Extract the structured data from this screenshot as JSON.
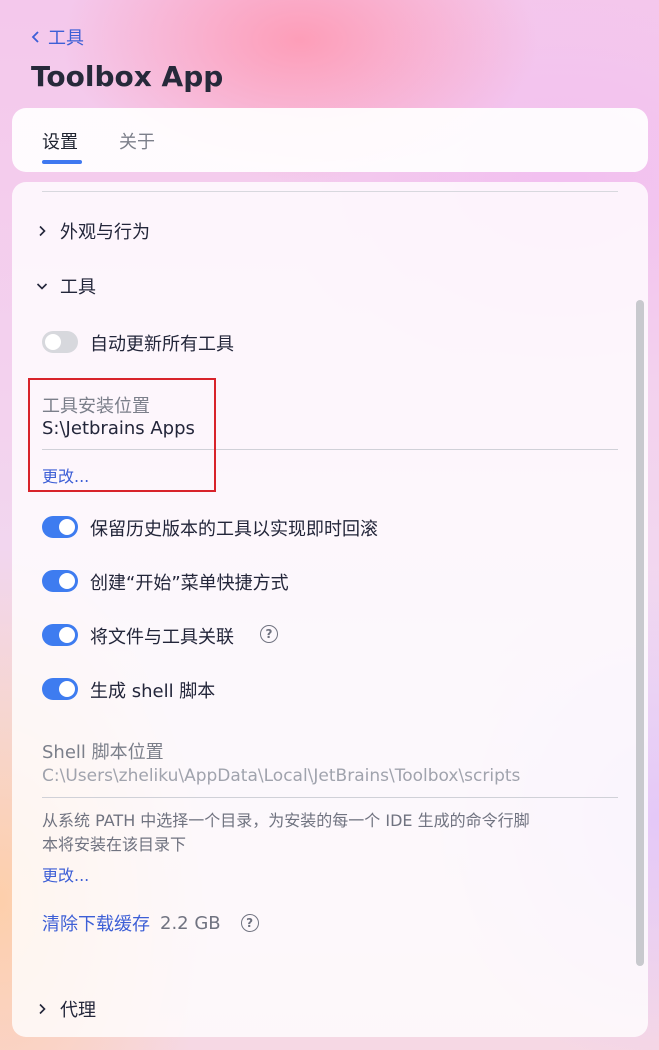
{
  "header": {
    "back_label": "工具",
    "title": "Toolbox App"
  },
  "tabs": [
    {
      "label": "设置",
      "active": true
    },
    {
      "label": "关于",
      "active": false
    }
  ],
  "sections": {
    "appearance": "外观与行为",
    "tools": "工具",
    "proxy": "代理"
  },
  "options": {
    "auto_update": {
      "label": "自动更新所有工具",
      "enabled": false
    },
    "keep_rollback": {
      "label": "保留历史版本的工具以实现即时回滚",
      "enabled": true
    },
    "start_menu": {
      "label": "创建“开始”菜单快捷方式",
      "enabled": true
    },
    "associate_files": {
      "label": "将文件与工具关联",
      "enabled": true
    },
    "shell_scripts": {
      "label": "生成 shell 脚本",
      "enabled": true
    }
  },
  "install_location": {
    "label": "工具安装位置",
    "value": "S:\\Jetbrains Apps",
    "change": "更改..."
  },
  "shell_location": {
    "label": "Shell 脚本位置",
    "value": "C:\\Users\\zheliku\\AppData\\Local\\JetBrains\\Toolbox\\scripts",
    "description": "从系统 PATH 中选择一个目录，为安装的每一个 IDE 生成的命令行脚本将安装在该目录下",
    "change": "更改..."
  },
  "cache": {
    "label": "清除下载缓存",
    "size": "2.2 GB"
  },
  "colors": {
    "accent": "#3e7cf0",
    "link": "#3d5fd6",
    "highlight": "#d8232a"
  },
  "icons": {
    "back": "chevron-left-icon",
    "collapsed": "chevron-right-icon",
    "expanded": "chevron-down-icon",
    "help": "question-circle-icon"
  }
}
